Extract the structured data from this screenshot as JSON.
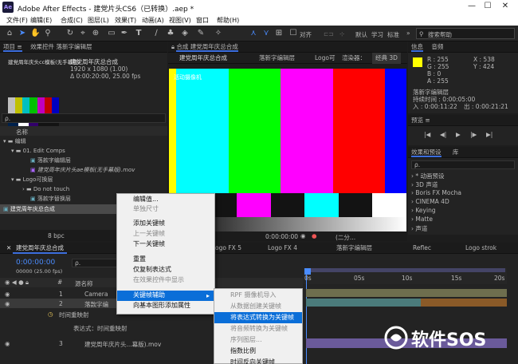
{
  "window": {
    "app_icon": "Ae",
    "title": "Adobe After Effects - 建党片头CS6（已转换）.aep *",
    "min": "—",
    "max": "☐",
    "close": "✕"
  },
  "menu": [
    "文件(F)",
    "编辑(E)",
    "合成(C)",
    "图层(L)",
    "效果(T)",
    "动画(A)",
    "视图(V)",
    "窗口",
    "帮助(H)"
  ],
  "toolbar": {
    "snap_label": "对齐",
    "workspace_default": "默认",
    "workspace_learn": "学习",
    "workspace_standard": "标准",
    "search_placeholder": "搜索帮助"
  },
  "project": {
    "tab_project": "项目 ≡",
    "tab_fx": "效果控件 落新字编辑层",
    "thumb_name": "建党周年庆头cc模板(无手幕版)",
    "comp_name": "建党周年庆总合成",
    "comp_size": "1920 x 1080 (1.00)",
    "comp_dur": "Δ 0:00:20:00, 25.00 fps",
    "search": "ρ.",
    "col_name": "名称",
    "items": [
      "编辑",
      "01. Edit Comps",
      "落款字编辑层",
      "建党周年庆片头ae模板(无手幕版).mov",
      "Logo可换层",
      "Do not touch",
      "落款字替换层",
      "建党周年庆总合成"
    ],
    "bpc": "8 bpc"
  },
  "comp": {
    "tab_label": "合成 建党周年庆总合成",
    "sub_tab": "建党周年庆总合成",
    "tab2": "落新字编辑层",
    "tab3": "Logo可",
    "renderer": "渲染器：",
    "renderer_value": "经典 3D",
    "active_camera": "活动摄像机",
    "time": "0:00:00:00",
    "fraction": "(二分..."
  },
  "info": {
    "tab_info": "信息",
    "tab_audio": "音频",
    "r": "R : 255",
    "g": "G : 255",
    "b": "B : 0",
    "a": "A : 255",
    "x": "X : 538",
    "y": "Y : 424",
    "layer_name": "落新字编辑层",
    "duration": "持续时间 : 0:00:05:00",
    "in_point": "入 : 0:00:11:22",
    "out_point": "出 : 0:00:21:21"
  },
  "preview": {
    "title": "预览 ≡",
    "controls": [
      "|◀",
      "◀|",
      "▶",
      "|▶",
      "▶|"
    ]
  },
  "effects": {
    "title": "效果和预设",
    "tab_lib": "库",
    "search": "ρ.",
    "items": [
      "* 动画预设",
      "3D 声道",
      "Boris FX Mocha",
      "CINEMA 4D",
      "Keying",
      "Matte",
      "声道"
    ]
  },
  "timeline": {
    "comp_tab": "建党周年庆总合成",
    "other_tabs": [
      "Logo FX 5",
      "Logo FX 4",
      "落新字编辑层",
      "Reflec",
      "Logo strok"
    ],
    "time": "0:00:00:00",
    "fps": "00000 (25.00 fps)",
    "search": "ρ.",
    "col_source": "源名称",
    "ruler": [
      "0s",
      "05s",
      "10s",
      "15s",
      "20s"
    ],
    "layers": [
      {
        "num": "1",
        "name": "Camera"
      },
      {
        "num": "2",
        "name": "落款字编"
      },
      {
        "num": "",
        "name": "时间重映射"
      },
      {
        "num": "",
        "name": "表达式：时间重映射"
      },
      {
        "num": "3",
        "name": "建党周年庆片头...幕版).mov"
      }
    ]
  },
  "context_menu": [
    "编辑值...",
    "单独尺寸",
    "添加关键帧",
    "上一关键帧",
    "下一关键帧",
    "重置",
    "仅复制表达式",
    "在效果控件中显示",
    "关键帧辅助",
    "向基本图形添加属性"
  ],
  "submenu": [
    "RPF 摄像机导入",
    "从数据创建关键帧",
    "将表达式转换为关键帧",
    "将音频转换为关键帧",
    "序列图层...",
    "指数比例",
    "时间反向关键帧"
  ],
  "watermark": "软件SOS",
  "colors": {
    "accent": "#3b6ddd",
    "highlight": "#0a6ed8",
    "timecode": "#4a8cff"
  }
}
